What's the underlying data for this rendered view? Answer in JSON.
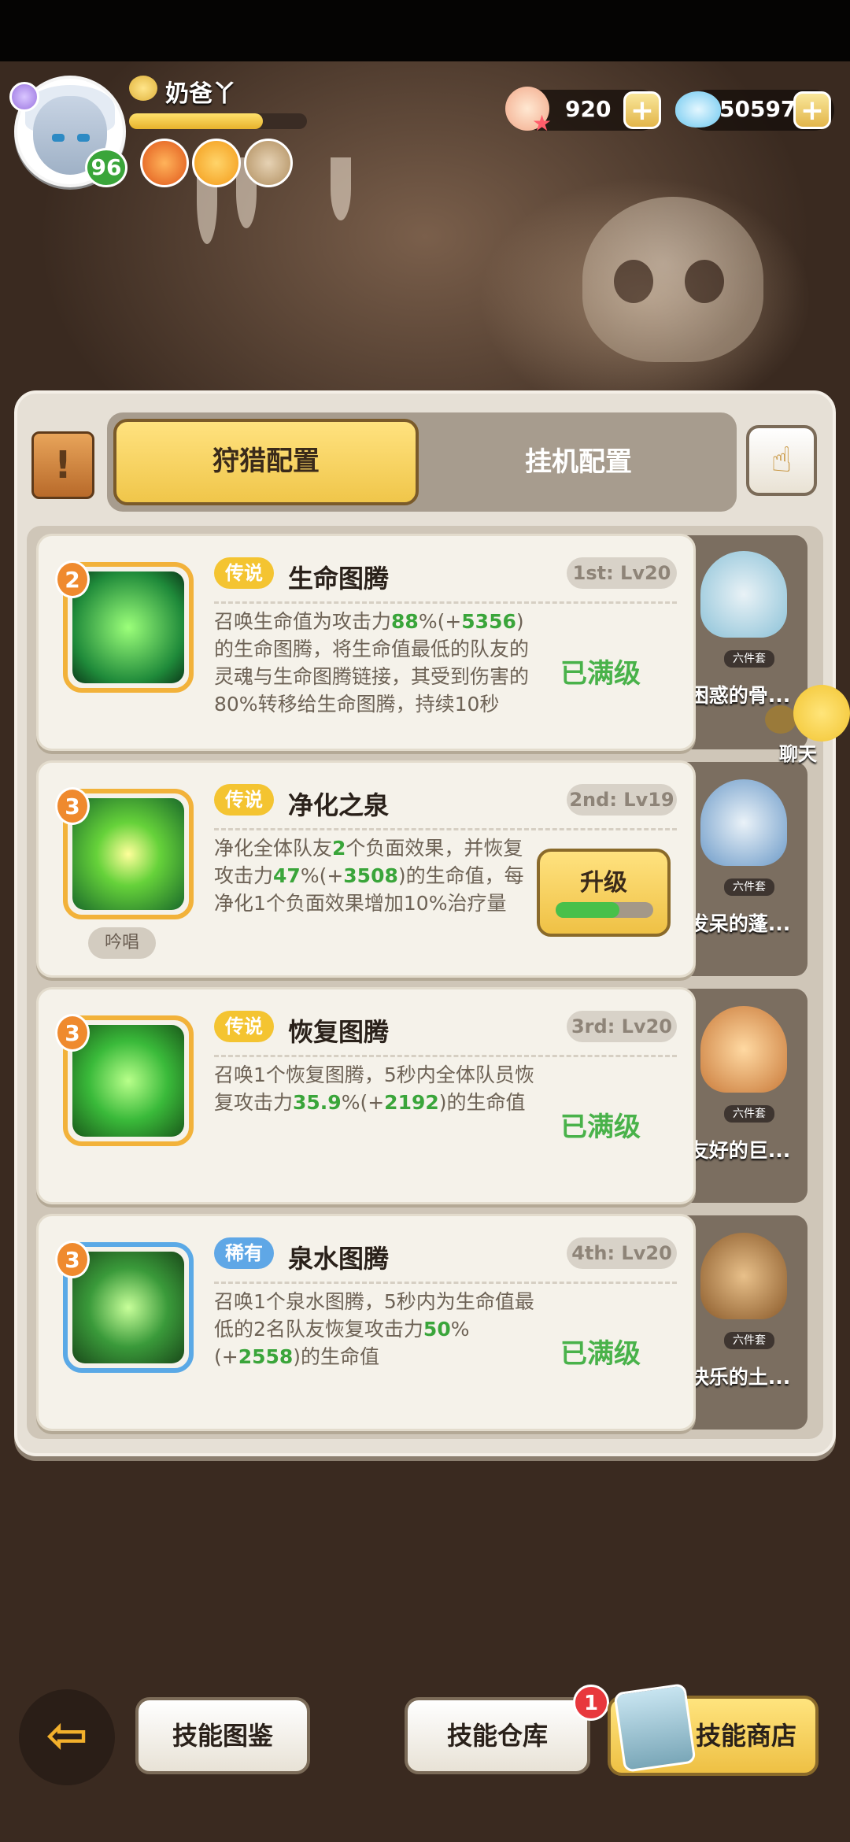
{
  "player": {
    "name": "奶爸丫",
    "level": "96",
    "exp_fraction": 0.75
  },
  "currency": {
    "shells": "920",
    "gems": "505972"
  },
  "tabs": {
    "active": "狩猎配置",
    "inactive": "挂机配置"
  },
  "skills": [
    {
      "star": "2",
      "rarity": "传说",
      "name": "生命图腾",
      "slot": "1st: Lv20",
      "desc_parts": [
        "召唤生命值为攻击力",
        "88",
        "%(+",
        "5356",
        ")的生命图腾，将生命值最低的队友的灵魂与生命图腾链接，其受到伤害的80%转移给生命图腾，持续10秒"
      ],
      "status": "已满级",
      "companion": "困惑的骨...",
      "companion_tag": "六件套"
    },
    {
      "star": "3",
      "rarity": "传说",
      "name": "净化之泉",
      "slot": "2nd: Lv19",
      "desc_parts": [
        "净化全体队友",
        "2",
        "个负面效果，并恢复攻击力",
        "47",
        "%(+",
        "3508",
        ")的生命值，每净化1个负面效果增加10%治疗量"
      ],
      "cast_tag": "吟唱",
      "upgrade_label": "升级",
      "upgrade_progress": 0.65,
      "companion": "发呆的蓬...",
      "companion_tag": "六件套"
    },
    {
      "star": "3",
      "rarity": "传说",
      "name": "恢复图腾",
      "slot": "3rd: Lv20",
      "desc_parts": [
        "召唤1个恢复图腾，5秒内全体队员恢复攻击力",
        "35.9",
        "%(+",
        "2192",
        ")的生命值"
      ],
      "status": "已满级",
      "companion": "友好的巨...",
      "companion_tag": "六件套"
    },
    {
      "star": "3",
      "rarity": "稀有",
      "name": "泉水图腾",
      "slot": "4th: Lv20",
      "desc_parts": [
        "召唤1个泉水图腾，5秒内为生命值最低的2名队友恢复攻击力",
        "50",
        "%(+",
        "2558",
        ")的生命值"
      ],
      "status": "已满级",
      "companion": "快乐的土...",
      "companion_tag": "六件套"
    }
  ],
  "chat_label": "聊天",
  "bottom": {
    "codex": "技能图鉴",
    "storage": "技能仓库",
    "shop": "技能商店",
    "notification": "1"
  }
}
